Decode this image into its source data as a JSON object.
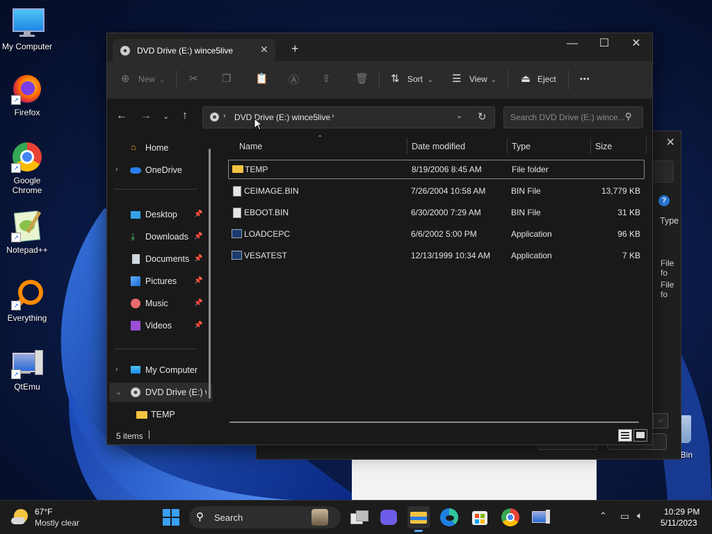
{
  "desktop": {
    "icons": [
      {
        "label": "My Computer"
      },
      {
        "label": "Firefox"
      },
      {
        "label": "Google Chrome"
      },
      {
        "label": "Notepad++"
      },
      {
        "label": "Everything"
      },
      {
        "label": "QtEmu"
      }
    ],
    "recycle_bin_partial": "le Bin"
  },
  "background_window": {
    "type_header": "Type",
    "rows": [
      "File fo",
      "File fo"
    ]
  },
  "explorer": {
    "tab_title": "DVD Drive (E:) wince5live",
    "toolbar": {
      "new": "New",
      "sort": "Sort",
      "view": "View",
      "eject": "Eject",
      "more": "•••"
    },
    "address": {
      "path": "DVD Drive (E:) wince5live"
    },
    "search": {
      "placeholder": "Search DVD Drive (E:) wince..."
    },
    "sidebar": {
      "home": "Home",
      "onedrive": "OneDrive",
      "pinned": [
        {
          "label": "Desktop"
        },
        {
          "label": "Downloads"
        },
        {
          "label": "Documents"
        },
        {
          "label": "Pictures"
        },
        {
          "label": "Music"
        },
        {
          "label": "Videos"
        }
      ],
      "my_computer": "My Computer",
      "dvd_drive": "DVD Drive (E:) w",
      "temp": "TEMP"
    },
    "columns": {
      "name": "Name",
      "date": "Date modified",
      "type": "Type",
      "size": "Size"
    },
    "files": [
      {
        "name": "TEMP",
        "date": "8/19/2006 8:45 AM",
        "type": "File folder",
        "size": ""
      },
      {
        "name": "CEIMAGE.BIN",
        "date": "7/26/2004 10:58 AM",
        "type": "BIN File",
        "size": "13,779 KB"
      },
      {
        "name": "EBOOT.BIN",
        "date": "6/30/2000 7:29 AM",
        "type": "BIN File",
        "size": "31 KB"
      },
      {
        "name": "LOADCEPC",
        "date": "6/6/2002 5:00 PM",
        "type": "Application",
        "size": "96 KB"
      },
      {
        "name": "VESATEST",
        "date": "12/13/1999 10:34 AM",
        "type": "Application",
        "size": "7 KB"
      }
    ],
    "status": {
      "count": "5 items"
    }
  },
  "taskbar": {
    "weather": {
      "temp": "67°F",
      "desc": "Mostly clear"
    },
    "search_label": "Search",
    "time": "10:29 PM",
    "date": "5/11/2023"
  },
  "colors": {
    "accent": "#0078d4",
    "folder": "#f5c342",
    "window_bg": "#191919",
    "toolbar_bg": "#2b2b2b"
  }
}
